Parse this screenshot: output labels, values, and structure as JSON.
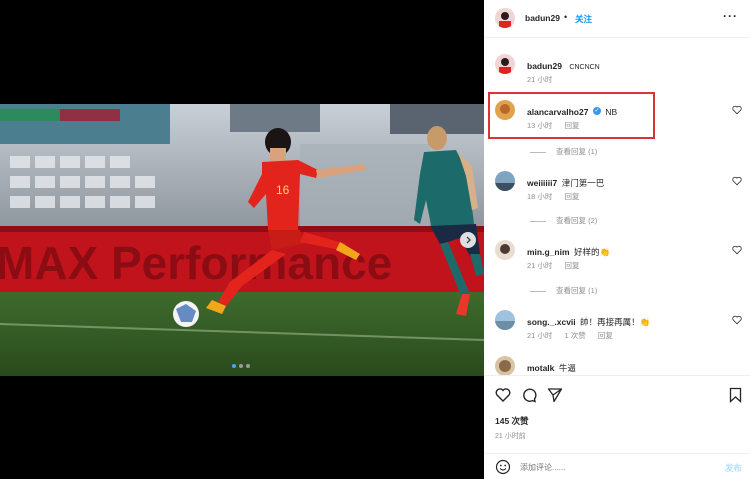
{
  "post": {
    "author": "badun29",
    "follow_label": "关注",
    "more_icon": "more-icon",
    "caption_text": "CNCNCN",
    "caption_time": "21 小时"
  },
  "comments": [
    {
      "user": "alancarvalho27",
      "verified": true,
      "text": "NB",
      "time": "13 小时",
      "reply_label": "回复",
      "likes": "",
      "replies_label": "查看回复 (1)"
    },
    {
      "user": "weiiiiii7",
      "text": "津门第一巴",
      "time": "18 小时",
      "reply_label": "回复",
      "likes": "",
      "replies_label": "查看回复 (2)"
    },
    {
      "user": "min.g_nim",
      "text": "好样的👏",
      "time": "21 小时",
      "reply_label": "回复",
      "likes": "",
      "replies_label": "查看回复 (1)"
    },
    {
      "user": "song._.xcvii",
      "text": "帥！再接再厲！👏",
      "time": "21 小时",
      "reply_label": "回复",
      "likes": "1 次赞",
      "replies_label": ""
    },
    {
      "user": "motalk",
      "text": "牛逼",
      "time": "",
      "reply_label": "",
      "likes": "",
      "replies_label": ""
    }
  ],
  "stats": {
    "likes": "145 次赞",
    "time": "21 小时前"
  },
  "add_comment": {
    "placeholder": "添加评论......",
    "post_label": "发布"
  },
  "colors": {
    "accent": "#0095f6",
    "highlight_box": "#d93434",
    "jersey_red": "#e3241d",
    "jersey_teal": "#1d6a6a"
  },
  "carousel": {
    "current": 1,
    "total": 3
  }
}
